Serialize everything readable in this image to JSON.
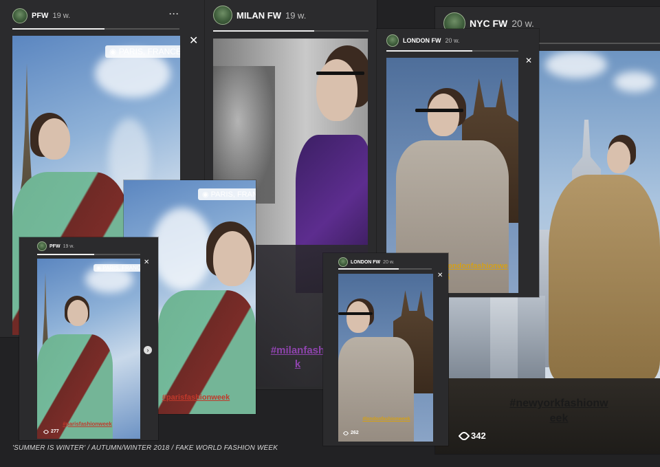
{
  "stories": {
    "pfw": {
      "username": "PFW",
      "time": "19 w.",
      "location": "PARIS, FRANCE",
      "hashtag": "#parisfashionweek",
      "views": "277"
    },
    "milan": {
      "username": "MILAN FW",
      "time": "19 w.",
      "hashtag": "#milanfashionweek_display",
      "hashtag_line1": "#milanfash",
      "hashtag_line2": "k"
    },
    "london": {
      "username": "LONDON FW",
      "time": "20 w.",
      "hashtag": "#londonfashionweek",
      "hashtag_mid": "#londonfashionwe",
      "hashtag_mid2": "ek",
      "views": "262"
    },
    "nyc": {
      "username": "NYC FW",
      "time": "20 w.",
      "hashtag_line1": "#newyorkfashionw",
      "hashtag_line2": "eek",
      "views": "342"
    }
  },
  "menu_glyph": "···",
  "close_glyph": "✕",
  "next_glyph": "›",
  "caption": "'SUMMER IS WINTER' / AUTUMN/WINTER 2018 / FAKE WORLD FASHION WEEK",
  "colors": {
    "background": "#222224",
    "card": "#2b2b2d",
    "hashtag_red": "#c0392b",
    "hashtag_purple": "#8e44ad",
    "hashtag_orange": "#d4a017"
  }
}
